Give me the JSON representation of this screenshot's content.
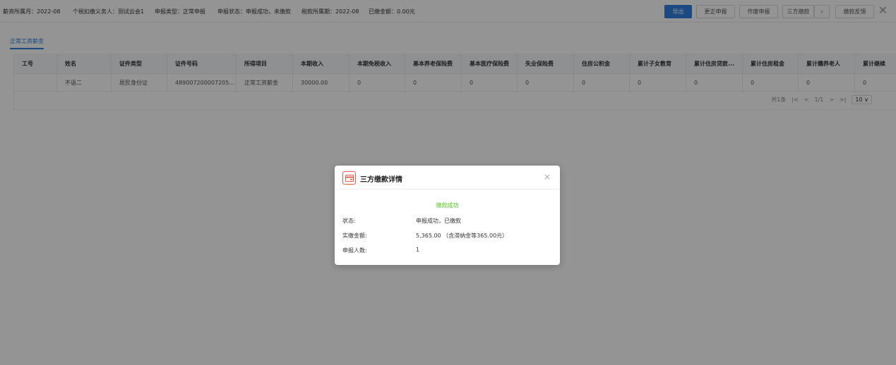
{
  "header": {
    "salary_month": "薪资所属月：2022-08",
    "withholding_agent": "个税扣缴义务人：测试云会1",
    "declare_type": "申报类型：正常申报",
    "declare_status": "申报状态：申报成功，未缴款",
    "tax_period": "税款所属期：2022-08",
    "paid_amount": "已缴金额：0.00元"
  },
  "toolbar": {
    "export": "导出",
    "correct": "更正申报",
    "void": "作废申报",
    "third_party_pay": "三方缴款",
    "pay_feedback": "缴款反馈",
    "close": "✕",
    "dropdown": "∨"
  },
  "tabs": [
    {
      "label": "正常工资薪金"
    }
  ],
  "table": {
    "columns": [
      "工号",
      "姓名",
      "证件类型",
      "证件号码",
      "所得项目",
      "本期收入",
      "本期免税收入",
      "基本养老保险费",
      "基本医疗保险费",
      "失业保险费",
      "住房公积金",
      "累计子女教育",
      "累计住房贷款...",
      "累计住房租金",
      "累计赡养老人",
      "累计继续"
    ],
    "rows": [
      [
        "",
        "不语二",
        "居民身份证",
        "4890072000072057...",
        "正常工资薪金",
        "30000.00",
        "0",
        "0",
        "0",
        "0",
        "0",
        "0",
        "0",
        "0",
        "0",
        "0"
      ]
    ]
  },
  "pagination": {
    "total": "共1条",
    "page": "1/1",
    "first": "|<",
    "prev": "<",
    "next": ">",
    "last": ">|",
    "page_size": "10 ∨"
  },
  "modal": {
    "title": "三方缴款详情",
    "close": "×",
    "status_message": "缴款成功",
    "fields": [
      {
        "label": "状态:",
        "value": "申报成功，已缴款"
      },
      {
        "label": "实缴金额:",
        "value": "5,365.00 （含滞纳金等365.00元）"
      },
      {
        "label": "申报人数:",
        "value": "1"
      }
    ]
  },
  "colors": {
    "primary": "#2f7fe0",
    "success": "#52c41a",
    "modal_icon": "#e85b4b"
  }
}
